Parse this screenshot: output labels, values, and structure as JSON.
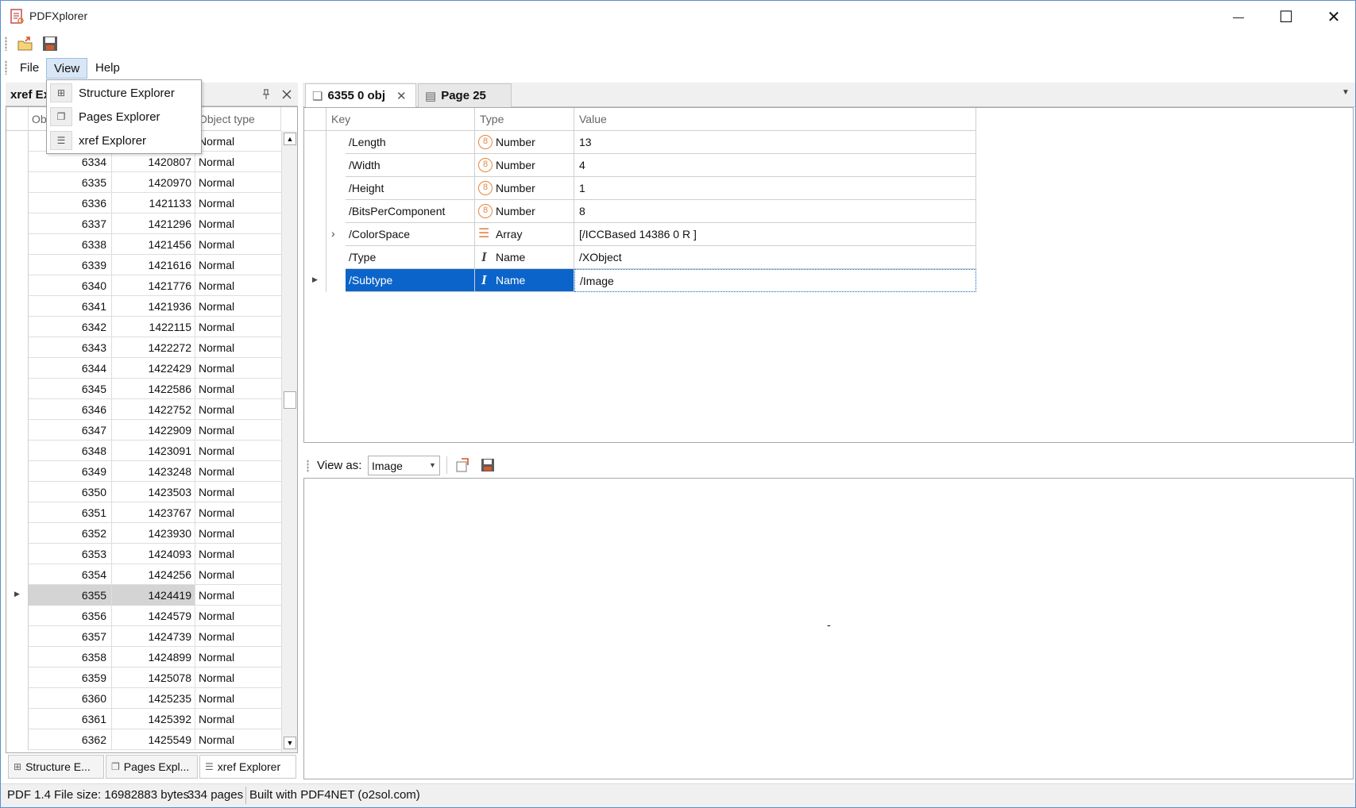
{
  "window": {
    "title": "PDFXplorer",
    "minimize": "—",
    "maximize": "☐",
    "close": "✕"
  },
  "menu": {
    "file": "File",
    "view": "View",
    "help": "Help"
  },
  "view_menu": [
    {
      "label": "Structure Explorer",
      "icon": "structure-icon"
    },
    {
      "label": "Pages Explorer",
      "icon": "pages-icon"
    },
    {
      "label": "xref Explorer",
      "icon": "xref-icon"
    }
  ],
  "left_panel": {
    "title": "xref Ex",
    "columns": {
      "obj": "Obj",
      "offset": "",
      "type": "Object type"
    },
    "first_row_type": "Normal",
    "rows": [
      {
        "num": "6334",
        "offset": "1420807",
        "type": "Normal"
      },
      {
        "num": "6335",
        "offset": "1420970",
        "type": "Normal"
      },
      {
        "num": "6336",
        "offset": "1421133",
        "type": "Normal"
      },
      {
        "num": "6337",
        "offset": "1421296",
        "type": "Normal"
      },
      {
        "num": "6338",
        "offset": "1421456",
        "type": "Normal"
      },
      {
        "num": "6339",
        "offset": "1421616",
        "type": "Normal"
      },
      {
        "num": "6340",
        "offset": "1421776",
        "type": "Normal"
      },
      {
        "num": "6341",
        "offset": "1421936",
        "type": "Normal"
      },
      {
        "num": "6342",
        "offset": "1422115",
        "type": "Normal"
      },
      {
        "num": "6343",
        "offset": "1422272",
        "type": "Normal"
      },
      {
        "num": "6344",
        "offset": "1422429",
        "type": "Normal"
      },
      {
        "num": "6345",
        "offset": "1422586",
        "type": "Normal"
      },
      {
        "num": "6346",
        "offset": "1422752",
        "type": "Normal"
      },
      {
        "num": "6347",
        "offset": "1422909",
        "type": "Normal"
      },
      {
        "num": "6348",
        "offset": "1423091",
        "type": "Normal"
      },
      {
        "num": "6349",
        "offset": "1423248",
        "type": "Normal"
      },
      {
        "num": "6350",
        "offset": "1423503",
        "type": "Normal"
      },
      {
        "num": "6351",
        "offset": "1423767",
        "type": "Normal"
      },
      {
        "num": "6352",
        "offset": "1423930",
        "type": "Normal"
      },
      {
        "num": "6353",
        "offset": "1424093",
        "type": "Normal"
      },
      {
        "num": "6354",
        "offset": "1424256",
        "type": "Normal"
      },
      {
        "num": "6355",
        "offset": "1424419",
        "type": "Normal"
      },
      {
        "num": "6356",
        "offset": "1424579",
        "type": "Normal"
      },
      {
        "num": "6357",
        "offset": "1424739",
        "type": "Normal"
      },
      {
        "num": "6358",
        "offset": "1424899",
        "type": "Normal"
      },
      {
        "num": "6359",
        "offset": "1425078",
        "type": "Normal"
      },
      {
        "num": "6360",
        "offset": "1425235",
        "type": "Normal"
      },
      {
        "num": "6361",
        "offset": "1425392",
        "type": "Normal"
      },
      {
        "num": "6362",
        "offset": "1425549",
        "type": "Normal"
      }
    ],
    "selected": "6355",
    "bottom_tabs": [
      "Structure E...",
      "Pages Expl...",
      "xref Explorer"
    ]
  },
  "right_panel": {
    "tabs": [
      {
        "label": "6355 0 obj"
      },
      {
        "label": "Page 25"
      }
    ],
    "columns": {
      "key": "Key",
      "type": "Type",
      "value": "Value"
    },
    "props": [
      {
        "key": "/Length",
        "type": "Number",
        "value": "13",
        "icon": "number-icon"
      },
      {
        "key": "/Width",
        "type": "Number",
        "value": "4",
        "icon": "number-icon"
      },
      {
        "key": "/Height",
        "type": "Number",
        "value": "1",
        "icon": "number-icon"
      },
      {
        "key": "/BitsPerComponent",
        "type": "Number",
        "value": "8",
        "icon": "number-icon"
      },
      {
        "key": "/ColorSpace",
        "type": "Array",
        "value": "[/ICCBased 14386 0 R ]",
        "icon": "array-icon"
      },
      {
        "key": "/Type",
        "type": "Name",
        "value": "/XObject",
        "icon": "name-icon"
      },
      {
        "key": "/Subtype",
        "type": "Name",
        "value": "/Image",
        "icon": "name-icon"
      }
    ],
    "view_as_label": "View as:",
    "view_as_value": "Image",
    "preview_dash": "-"
  },
  "status": {
    "version": "PDF 1.4",
    "size": "File size: 16982883 bytes",
    "pages": "334 pages",
    "built": "Built with PDF4NET (o2sol.com)"
  }
}
